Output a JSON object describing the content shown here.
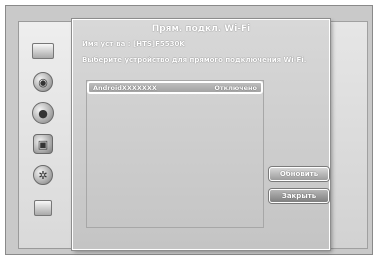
{
  "dialog": {
    "title": "Прям. подкл. Wi-Fi",
    "device_name": "Имя уст-ва : [HTS]F5530K",
    "instruction": "Выберите устройство для прямого подключения Wi-Fi."
  },
  "devices": [
    {
      "name": "AndroidXXXXXXX",
      "status": "Отключено"
    }
  ],
  "buttons": {
    "refresh": "Обновить",
    "close": "Закрыть"
  },
  "sidebar": {
    "icons": [
      "picture-icon",
      "speaker-icon",
      "globe-icon",
      "box-icon",
      "gear-icon",
      "help-icon"
    ]
  },
  "colors": {
    "panel_background": "#c9c9c9",
    "dialog_background": "#cfcfcf",
    "text": "#ffffff"
  }
}
